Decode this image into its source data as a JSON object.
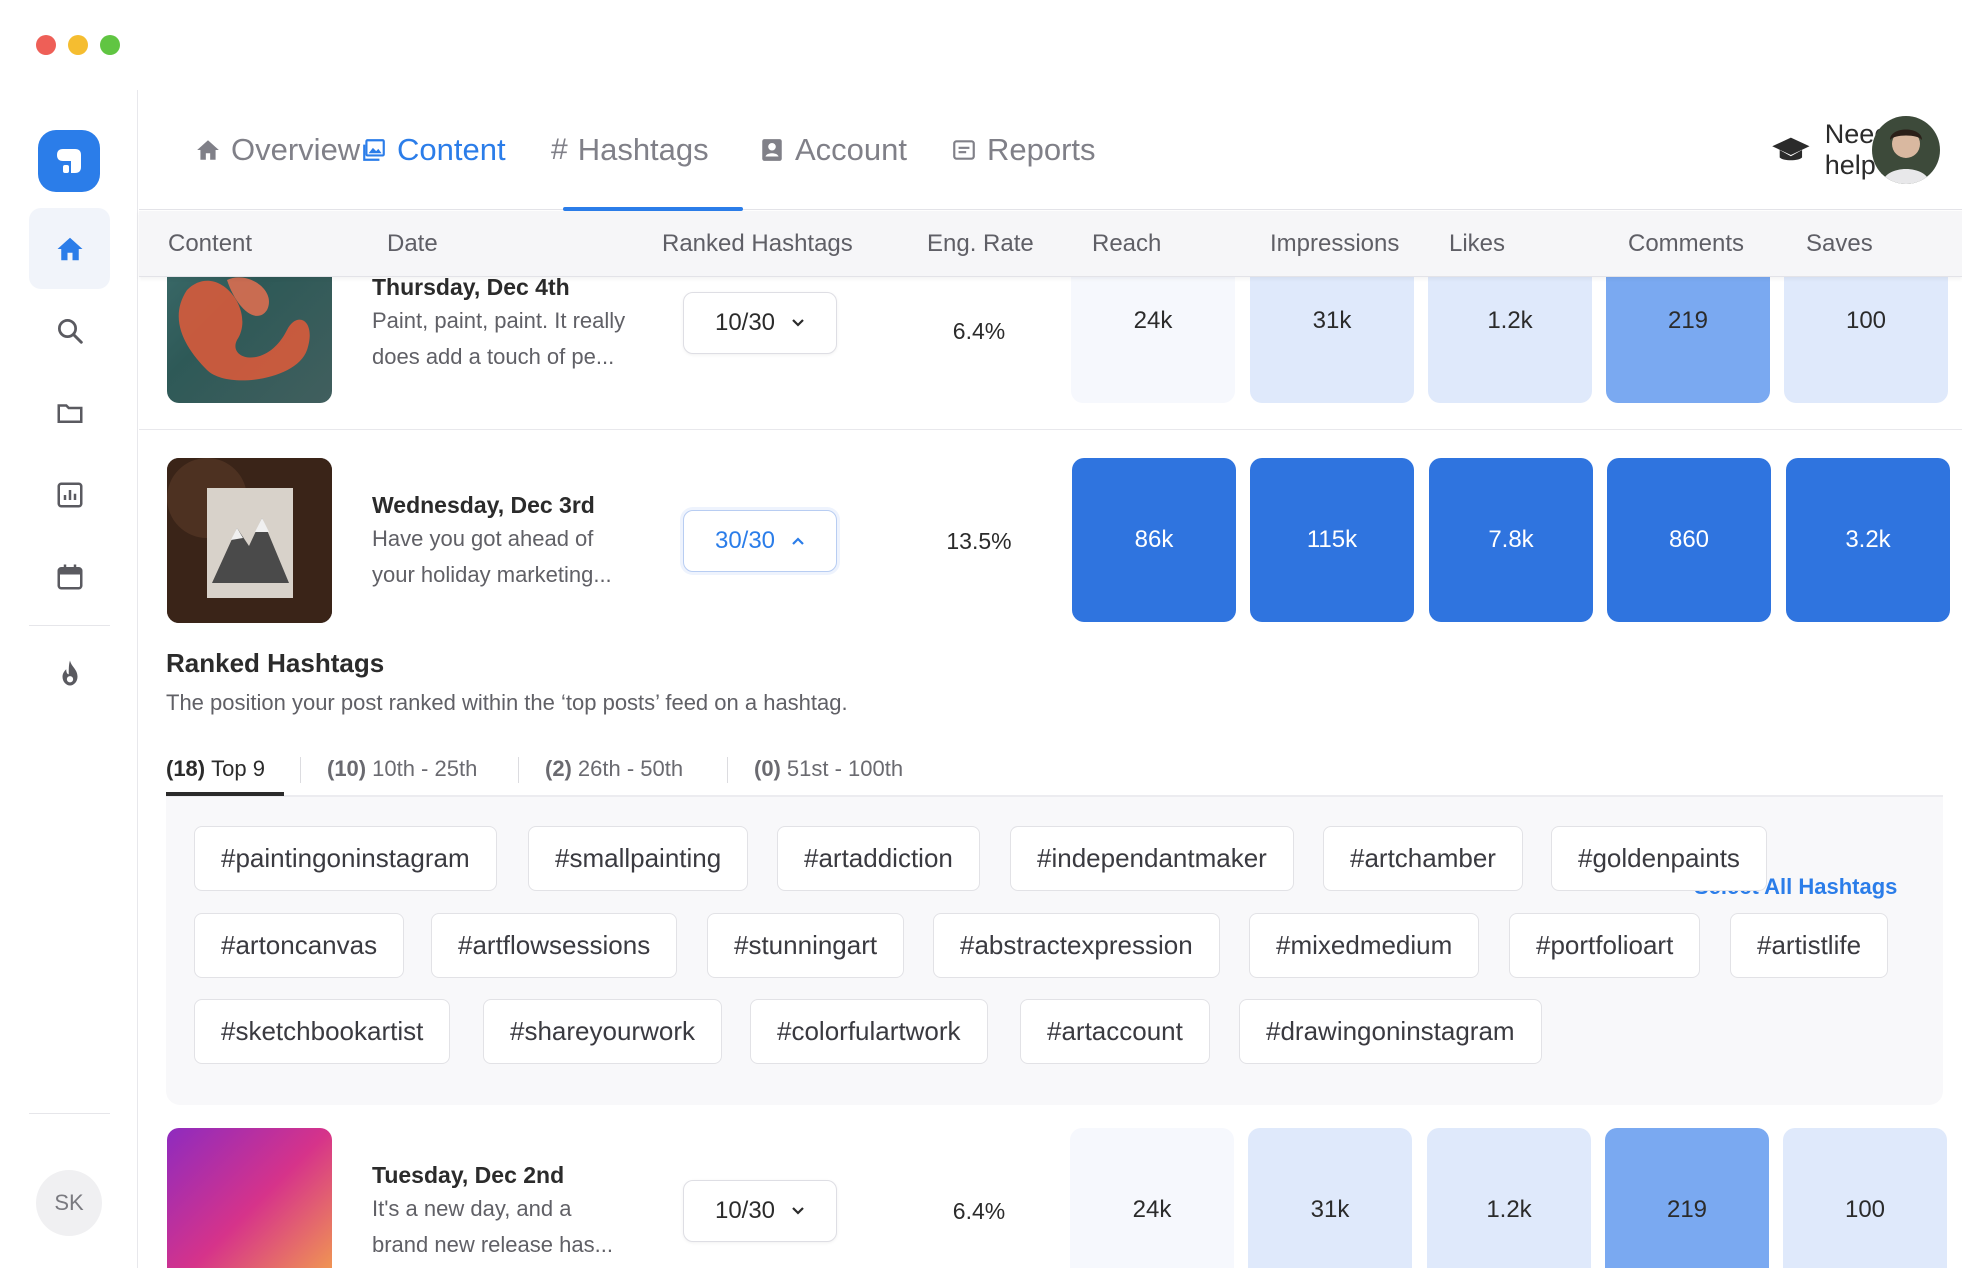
{
  "window": {
    "dot_colors": [
      "#ee5f57",
      "#f5bd30",
      "#60c542"
    ]
  },
  "sidebar": {
    "logo_icon": "app-logo-icon",
    "items": [
      "home-icon",
      "search-icon",
      "folder-icon",
      "chart-icon",
      "calendar-icon",
      "fire-icon"
    ],
    "user_initials": "SK"
  },
  "nav": {
    "tabs": [
      {
        "label": "Overview",
        "icon": "home-icon"
      },
      {
        "label": "Content",
        "icon": "image-icon"
      },
      {
        "label": "Hashtags",
        "icon": "hash-icon"
      },
      {
        "label": "Account",
        "icon": "account-icon"
      },
      {
        "label": "Reports",
        "icon": "reports-icon"
      }
    ],
    "active_tab": "Content",
    "help_label": "Need help?"
  },
  "table": {
    "columns": [
      "Content",
      "Date",
      "Ranked Hashtags",
      "Eng. Rate",
      "Reach",
      "Impressions",
      "Likes",
      "Comments",
      "Saves"
    ],
    "rows": [
      {
        "date": "Thursday, Dec 4th",
        "caption_line1": "Paint, paint, paint. It really",
        "caption_line2": "does add a touch of pe...",
        "ranked": "10/30",
        "eng_rate": "6.4%",
        "reach": "24k",
        "impressions": "31k",
        "likes": "1.2k",
        "comments": "219",
        "saves": "100"
      },
      {
        "date": "Wednesday,  Dec 3rd",
        "caption_line1": "Have you got ahead of",
        "caption_line2": "your holiday marketing...",
        "ranked": "30/30",
        "eng_rate": "13.5%",
        "reach": "86k",
        "impressions": "115k",
        "likes": "7.8k",
        "comments": "860",
        "saves": "3.2k"
      },
      {
        "date": "Tuesday,  Dec 2nd",
        "caption_line1": "It's a new day, and a",
        "caption_line2": "brand new release has...",
        "ranked": "10/30",
        "eng_rate": "6.4%",
        "reach": "24k",
        "impressions": "31k",
        "likes": "1.2k",
        "comments": "219",
        "saves": "100"
      }
    ]
  },
  "ranked_panel": {
    "title": "Ranked Hashtags",
    "subtitle": "The position your post ranked within the ‘top posts’ feed on a hashtag.",
    "tabs": [
      {
        "count": "(18)",
        "label": "Top 9"
      },
      {
        "count": "(10)",
        "label": "10th - 25th"
      },
      {
        "count": "(2)",
        "label": "26th - 50th"
      },
      {
        "count": "(0)",
        "label": "51st - 100th"
      }
    ],
    "select_all": "Select All Hashtags",
    "tags": [
      "#paintingoninstagram",
      "#smallpainting",
      "#artaddiction",
      "#independantmaker",
      "#artchamber",
      "#goldenpaints",
      "#artoncanvas",
      "#artflowsessions",
      "#stunningart",
      "#abstractexpression",
      "#mixedmedium",
      "#portfolioart",
      "#artistlife",
      "#sketchbookartist",
      "#shareyourwork",
      "#colorfulartwork",
      "#artaccount",
      "#drawingoninstagram"
    ]
  },
  "colors": {
    "accent": "#2b7de9",
    "heat_low": "#f6f8fd",
    "heat_mid": "#dfe9fb",
    "heat_high": "#7aa9f1",
    "heat_max": "#2f74df"
  }
}
